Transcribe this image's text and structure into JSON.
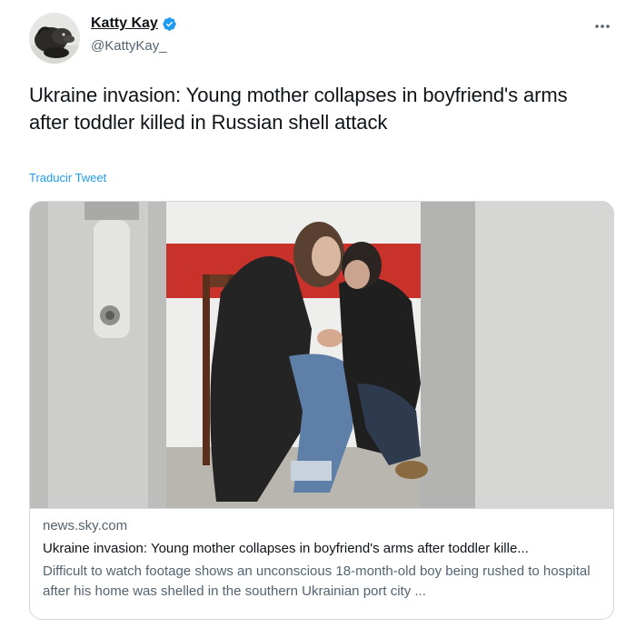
{
  "author": {
    "display_name": "Katty Kay",
    "handle": "@KattyKay_",
    "verified": true,
    "avatar_icon": "profile-photo"
  },
  "menu": {
    "more_icon": "more-horizontal-icon"
  },
  "tweet": {
    "text": "Ukraine invasion: Young mother collapses in boyfriend's arms after toddler killed in Russian shell attack",
    "translate_label": "Traducir Tweet"
  },
  "card": {
    "domain": "news.sky.com",
    "title": "Ukraine invasion: Young mother collapses in boyfriend's arms after toddler kille...",
    "description": "Difficult to watch footage shows an unconscious 18-month-old boy being rushed to hospital after his home was shelled in the southern Ukrainian port city ..."
  },
  "colors": {
    "link_blue": "#1d9bf0",
    "text_primary": "#0f1419",
    "text_secondary": "#536471",
    "border": "#cfd9de",
    "verified_blue": "#1d9bf0"
  }
}
